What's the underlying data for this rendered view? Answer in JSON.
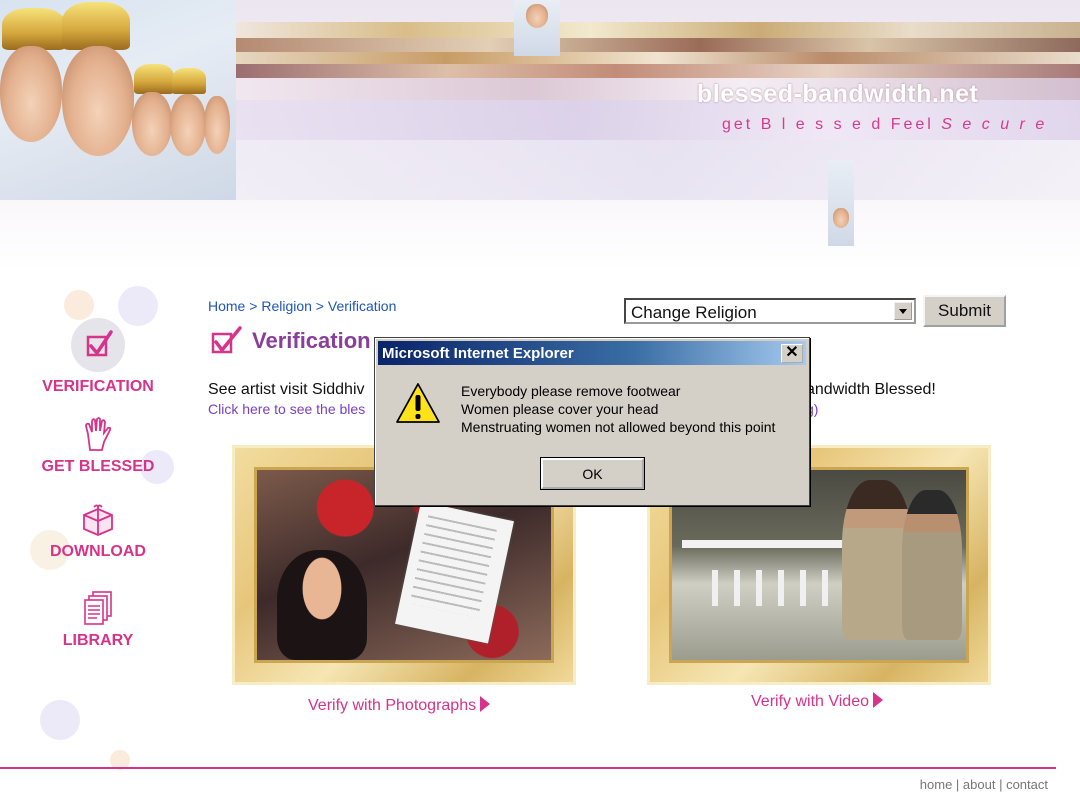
{
  "banner": {
    "site_title": "blessed-bandwidth.net",
    "tagline_part1": "get B l e s s e d   Feel ",
    "tagline_part2": "S e c u r e"
  },
  "sidebar": {
    "items": [
      {
        "label": "VERIFICATION",
        "icon": "checkmark-icon"
      },
      {
        "label": "GET BLESSED",
        "icon": "blessing-hand-icon"
      },
      {
        "label": "DOWNLOAD",
        "icon": "gift-box-icon"
      },
      {
        "label": "LIBRARY",
        "icon": "documents-icon"
      }
    ]
  },
  "breadcrumb": {
    "home": "Home",
    "sep": " > ",
    "religion": "Religion",
    "verification": "Verification"
  },
  "page": {
    "title": "Verification",
    "intro_left": "See artist visit Siddhiv",
    "intro_right": "andwidth Blessed!",
    "link_left": "Click here to see the bles",
    "link_right": "g)"
  },
  "religion_form": {
    "select_value": "Change Religion",
    "submit_label": "Submit"
  },
  "media": {
    "photos_link": "Verify with Photographs",
    "video_link": "Verify with Video"
  },
  "footer": {
    "home": "home",
    "about": "about",
    "contact": "contact",
    "sep": " | "
  },
  "alert": {
    "title": "Microsoft Internet Explorer",
    "close": "✕",
    "messages": [
      "Everybody please remove footwear",
      "Women please cover your head",
      "Menstruating women not allowed beyond this point"
    ],
    "ok_label": "OK",
    "icon": "warning-icon"
  },
  "colors": {
    "accent_pink": "#d6338a",
    "link_blue": "#1e56b8",
    "heading_purple": "#8a3d9a",
    "titlebar_blue": "#0a246a"
  }
}
